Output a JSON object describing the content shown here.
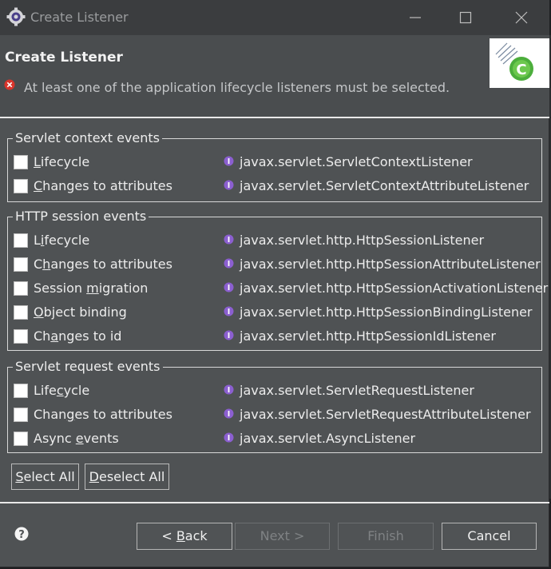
{
  "window": {
    "title": "Create Listener"
  },
  "header": {
    "title": "Create Listener",
    "error_message": "At least one of the application lifecycle listeners must be selected."
  },
  "groups": [
    {
      "legend": "Servlet context events",
      "items": [
        {
          "pre": "",
          "u": "L",
          "post": "ifecycle",
          "iface": "javax.servlet.ServletContextListener"
        },
        {
          "pre": "",
          "u": "C",
          "post": "hanges to attributes",
          "iface": "javax.servlet.ServletContextAttributeListener"
        }
      ]
    },
    {
      "legend": "HTTP session events",
      "items": [
        {
          "pre": "L",
          "u": "i",
          "post": "fecycle",
          "iface": "javax.servlet.http.HttpSessionListener"
        },
        {
          "pre": "C",
          "u": "h",
          "post": "anges to attributes",
          "iface": "javax.servlet.http.HttpSessionAttributeListener"
        },
        {
          "pre": "Session ",
          "u": "m",
          "post": "igration",
          "iface": "javax.servlet.http.HttpSessionActivationListener"
        },
        {
          "pre": "",
          "u": "O",
          "post": "bject binding",
          "iface": "javax.servlet.http.HttpSessionBindingListener"
        },
        {
          "pre": "Ch",
          "u": "a",
          "post": "nges to id",
          "iface": "javax.servlet.http.HttpSessionIdListener"
        }
      ]
    },
    {
      "legend": "Servlet request events",
      "items": [
        {
          "pre": "Life",
          "u": "c",
          "post": "ycle",
          "iface": "javax.servlet.ServletRequestListener"
        },
        {
          "pre": "Chan",
          "u": "g",
          "post": "es to attributes",
          "iface": "javax.servlet.ServletRequestAttributeListener"
        },
        {
          "pre": "Async ",
          "u": "e",
          "post": "vents",
          "iface": "javax.servlet.AsyncListener"
        }
      ]
    }
  ],
  "selection": {
    "select_all": {
      "u": "S",
      "post": "elect All"
    },
    "deselect_all": {
      "u": "D",
      "post": "eselect All"
    }
  },
  "nav": {
    "back": {
      "pre": "< ",
      "u": "B",
      "post": "ack"
    },
    "next": "Next >",
    "finish": "Finish",
    "cancel": "Cancel"
  },
  "colors": {
    "dialog_bg": "#4f5254",
    "error_red": "#d9342b",
    "interface_purple": "#8b5fd0"
  },
  "icons": {
    "app": "gear-icon",
    "error": "error-icon",
    "interface": "interface-icon",
    "help": "help-icon",
    "banner": "listener-wizard-banner"
  }
}
